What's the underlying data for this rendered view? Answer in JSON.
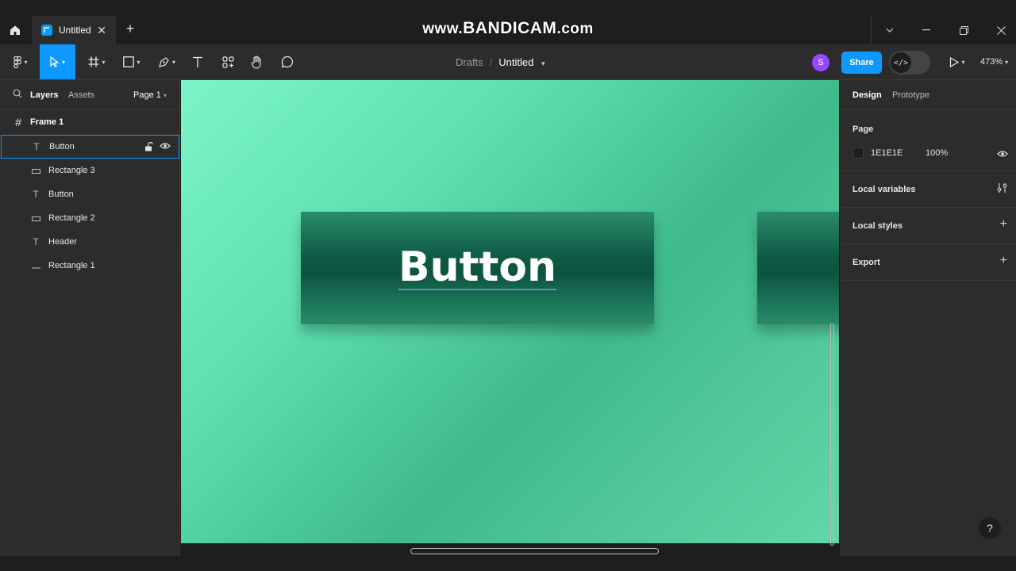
{
  "tabbar": {
    "file_tab_label": "Untitled",
    "close_glyph": "✕",
    "new_tab_glyph": "+",
    "watermark_prefix": "www.",
    "watermark_brand": "BANDICAM",
    "watermark_suffix": ".com"
  },
  "toolbar": {
    "breadcrumb_drafts": "Drafts",
    "breadcrumb_sep": "/",
    "file_title": "Untitled",
    "avatar_initial": "S",
    "share_label": "Share",
    "dev_mode_glyph": "</>",
    "zoom_label": "473%"
  },
  "left_panel": {
    "tab_layers": "Layers",
    "tab_assets": "Assets",
    "page_selector": "Page 1",
    "layers": [
      {
        "name": "Frame 1",
        "type": "frame"
      },
      {
        "name": "Button",
        "type": "text",
        "selected": true
      },
      {
        "name": "Rectangle 3",
        "type": "rectangle"
      },
      {
        "name": "Button",
        "type": "text"
      },
      {
        "name": "Rectangle 2",
        "type": "rectangle"
      },
      {
        "name": "Header",
        "type": "text"
      },
      {
        "name": "Rectangle 1",
        "type": "line"
      }
    ]
  },
  "canvas": {
    "button_text": "Button"
  },
  "right_panel": {
    "tab_design": "Design",
    "tab_prototype": "Prototype",
    "page_heading": "Page",
    "page_color_hex": "1E1E1E",
    "page_opacity": "100%",
    "local_variables": "Local variables",
    "local_styles": "Local styles",
    "export": "Export"
  },
  "help_glyph": "?",
  "colors": {
    "accent": "#0d99ff",
    "avatar": "#9747ff",
    "page_bg": "#1e1e1e",
    "panel_bg": "#2c2c2c"
  }
}
